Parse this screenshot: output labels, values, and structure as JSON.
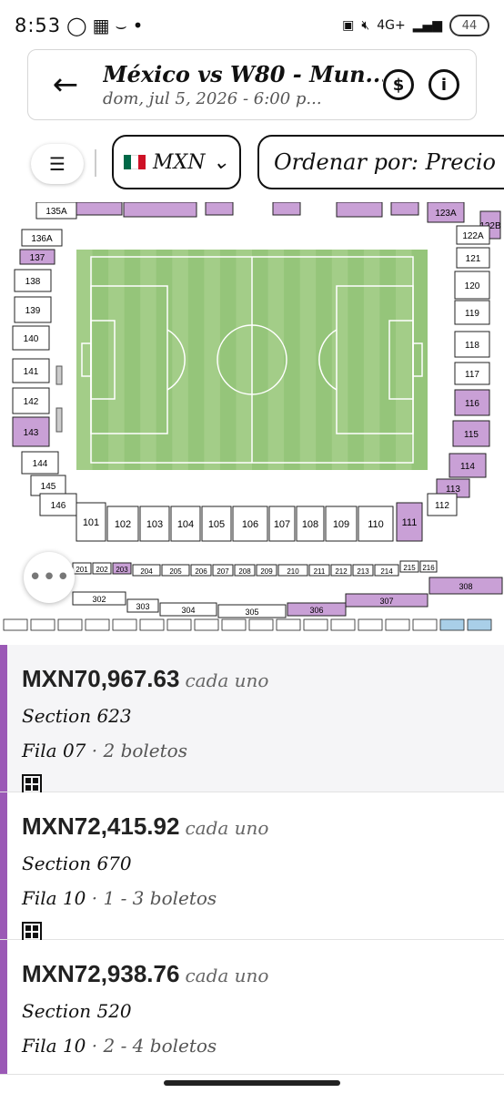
{
  "status_bar": {
    "time": "8:53",
    "network": "4G+",
    "battery": "44"
  },
  "header": {
    "title": "México vs W80 - Mun...",
    "subtitle": "dom, jul 5, 2026 - 6:00 p..."
  },
  "toolbar": {
    "currency": "MXN",
    "sort_label": "Ordenar por: Precio"
  },
  "colors": {
    "accent": "#9b59b6",
    "section_highlight": "#c9a0d6",
    "pitch": "#95c57a",
    "vip": "#a9cfe8"
  },
  "map": {
    "sections_left": [
      "135A",
      "136A",
      "137",
      "138",
      "139",
      "140",
      "141",
      "142",
      "143",
      "144",
      "145",
      "146"
    ],
    "sections_right": [
      "123A",
      "122B",
      "122A",
      "121",
      "120",
      "119",
      "118",
      "117",
      "116",
      "115",
      "114",
      "113",
      "112"
    ],
    "sections_bottom_100": [
      "101",
      "102",
      "103",
      "104",
      "105",
      "106",
      "107",
      "108",
      "109",
      "110",
      "111"
    ],
    "sections_200": [
      "201",
      "202",
      "203",
      "204",
      "205",
      "206",
      "207",
      "208",
      "209",
      "210",
      "211",
      "212",
      "213",
      "214",
      "215",
      "216"
    ],
    "sections_300": [
      "302",
      "303",
      "304",
      "305",
      "306",
      "307",
      "308"
    ]
  },
  "listings": [
    {
      "price": "MXN70,967.63",
      "each": "cada uno",
      "section": "Section 623",
      "row": "Fila 07",
      "qty": "· 2 boletos"
    },
    {
      "price": "MXN72,415.92",
      "each": "cada uno",
      "section": "Section 670",
      "row": "Fila 10",
      "qty": "· 1 - 3 boletos"
    },
    {
      "price": "MXN72,938.76",
      "each": "cada uno",
      "section": "Section 520",
      "row": "Fila 10",
      "qty": "· 2 - 4 boletos"
    }
  ]
}
